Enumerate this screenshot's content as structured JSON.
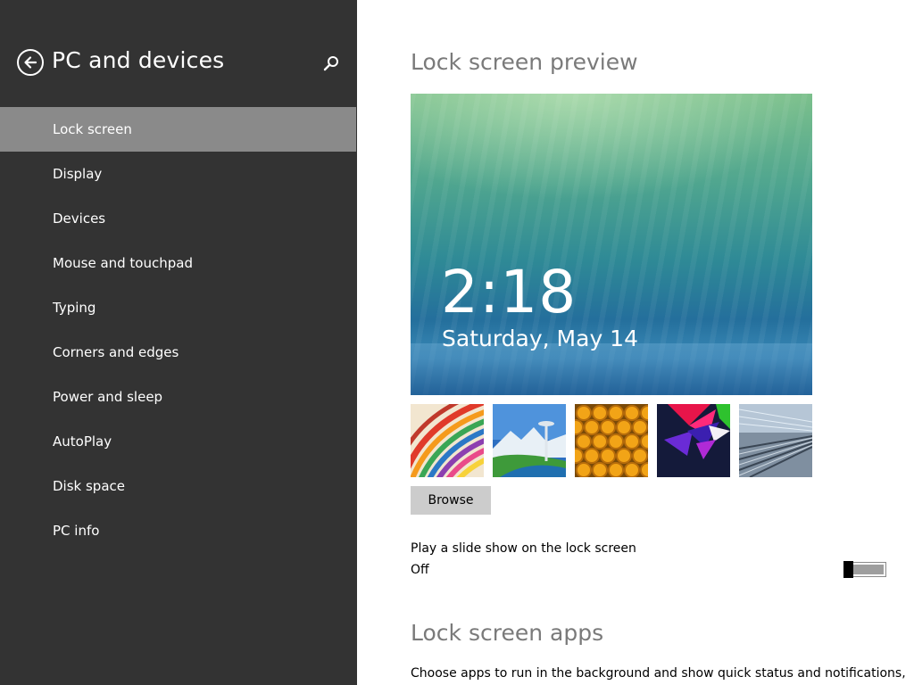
{
  "sidebar": {
    "title": "PC and devices",
    "back_icon": "back-arrow-icon",
    "search_icon": "search-icon",
    "items": [
      {
        "label": "Lock screen",
        "selected": true
      },
      {
        "label": "Display",
        "selected": false
      },
      {
        "label": "Devices",
        "selected": false
      },
      {
        "label": "Mouse and touchpad",
        "selected": false
      },
      {
        "label": "Typing",
        "selected": false
      },
      {
        "label": "Corners and edges",
        "selected": false
      },
      {
        "label": "Power and sleep",
        "selected": false
      },
      {
        "label": "AutoPlay",
        "selected": false
      },
      {
        "label": "Disk space",
        "selected": false
      },
      {
        "label": "PC info",
        "selected": false
      }
    ]
  },
  "main": {
    "preview_heading": "Lock screen preview",
    "preview_time": "2:18",
    "preview_date": "Saturday, May 14",
    "thumbnails": [
      {
        "name": "colorful-stripes"
      },
      {
        "name": "space-needle"
      },
      {
        "name": "honeycomb"
      },
      {
        "name": "geometric-shapes"
      },
      {
        "name": "tunnel-rails"
      }
    ],
    "browse_label": "Browse",
    "slideshow_label": "Play a slide show on the lock screen",
    "slideshow_state": "Off",
    "slideshow_on": false,
    "apps_heading": "Lock screen apps",
    "apps_description": "Choose apps to run in the background and show quick status and notifications,"
  },
  "colors": {
    "sidebar_bg": "#333333",
    "selected_item_bg": "#8a8a8a",
    "heading_gray": "#7a7a7a",
    "button_gray": "#cccccc"
  }
}
